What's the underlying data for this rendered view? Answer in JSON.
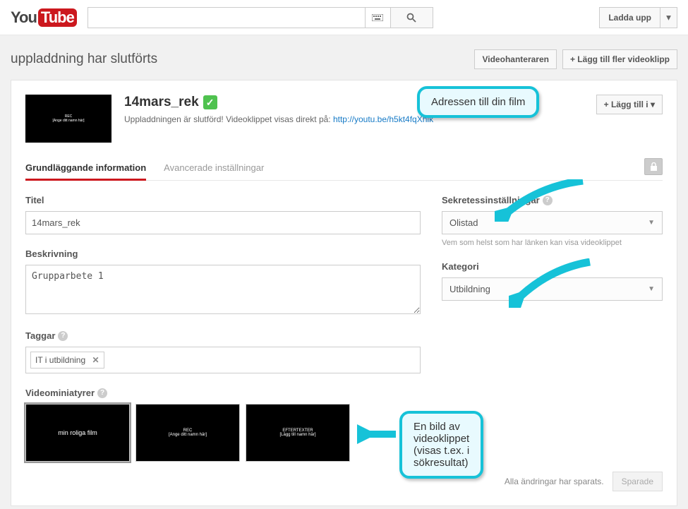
{
  "logo": {
    "you": "You",
    "tube": "Tube"
  },
  "search": {
    "value": "",
    "placeholder": ""
  },
  "top": {
    "upload": "Ladda upp"
  },
  "page": {
    "title": "uppladdning har slutförts",
    "video_manager": "Videohanteraren",
    "add_more": "+ Lägg till fler videoklipp"
  },
  "video": {
    "title": "14mars_rek",
    "status": "Uppladdningen är slutförd! Videoklippet visas direkt på: ",
    "link": "http://youtu.be/h5kt4fqXhlk",
    "add_to": "+ Lägg till i"
  },
  "tabs": {
    "basic": "Grundläggande information",
    "advanced": "Avancerade inställningar"
  },
  "form": {
    "title_label": "Titel",
    "title_value": "14mars_rek",
    "desc_label": "Beskrivning",
    "desc_value": "Grupparbete 1",
    "tags_label": "Taggar",
    "tag1": "IT i utbildning",
    "privacy_label": "Sekretessinställningar",
    "privacy_value": "Olistad",
    "privacy_hint": "Vem som helst som har länken kan visa videoklippet",
    "category_label": "Kategori",
    "category_value": "Utbildning",
    "thumbs_label": "Videominiatyrer"
  },
  "thumbs": {
    "t1": "min roliga film",
    "t2a": "REC",
    "t2b": "[Ange ditt namn här]",
    "t3a": "EFTERTEXTER",
    "t3b": "[Lägg till namn här]"
  },
  "footer": {
    "msg": "Alla ändringar har sparats.",
    "btn": "Sparade"
  },
  "callouts": {
    "c1": "Adressen till din film",
    "c2a": "En bild av videoklippet",
    "c2b": "(visas t.ex. i sökresultat)"
  }
}
